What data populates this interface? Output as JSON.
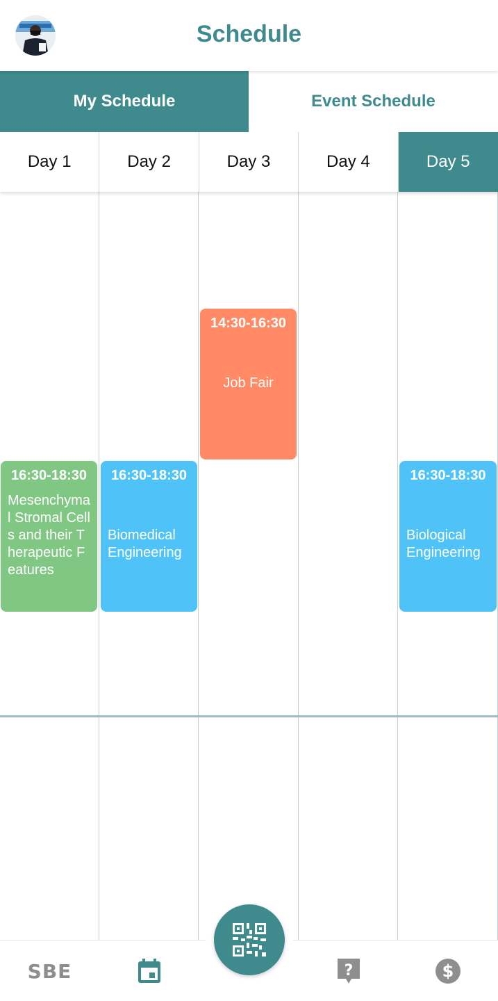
{
  "colors": {
    "accent": "#3f8a8c",
    "event_green": "#81c784",
    "event_blue": "#4fc3f7",
    "event_orange": "#ff8a65",
    "nav_gray": "#8e8e8e"
  },
  "header": {
    "title": "Schedule",
    "avatar_icon": "user-avatar"
  },
  "tabs": [
    {
      "label": "My Schedule",
      "active": true
    },
    {
      "label": "Event Schedule",
      "active": false
    }
  ],
  "days": [
    {
      "label": "Day 1",
      "active": false
    },
    {
      "label": "Day 2",
      "active": false
    },
    {
      "label": "Day 3",
      "active": false
    },
    {
      "label": "Day 4",
      "active": false
    },
    {
      "label": "Day 5",
      "active": true
    }
  ],
  "events": [
    {
      "day": "Day 1",
      "time": "16:30-18:30",
      "title": "Mesenchymal Stromal Cells and their Therapeutic Features",
      "color": "green"
    },
    {
      "day": "Day 2",
      "time": "16:30-18:30",
      "title": "Biomedical Engineering",
      "color": "blue"
    },
    {
      "day": "Day 3",
      "time": "14:30-16:30",
      "title": "Job Fair",
      "color": "orange"
    },
    {
      "day": "Day 5",
      "time": "16:30-18:30",
      "title": "Biological Engineering",
      "color": "blue"
    }
  ],
  "bottom_nav": {
    "items": [
      {
        "icon": "sbe-logo-icon",
        "text": "SBE"
      },
      {
        "icon": "calendar-icon",
        "active": true
      },
      {
        "icon": "qr-code-icon"
      },
      {
        "icon": "help-icon"
      },
      {
        "icon": "dollar-icon"
      }
    ]
  }
}
